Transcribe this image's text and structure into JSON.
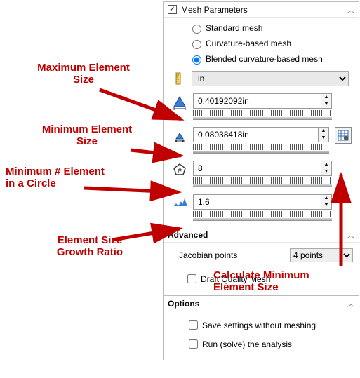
{
  "mesh_parameters": {
    "title": "Mesh Parameters",
    "checked": true,
    "radios": {
      "standard": "Standard mesh",
      "curvature": "Curvature-based mesh",
      "blended": "Blended curvature-based mesh"
    },
    "unit": "in",
    "max_element_size": "0.40192092in",
    "min_element_size": "0.08038418in",
    "min_elements_circle": "8",
    "growth_ratio": "1.6"
  },
  "advanced": {
    "title": "Advanced",
    "jacobian_label": "Jacobian points",
    "jacobian_value": "4 points",
    "draft_label": "Draft Quality Mesh"
  },
  "options": {
    "title": "Options",
    "save_label": "Save settings without meshing",
    "run_label": "Run (solve) the analysis"
  },
  "annotations": {
    "max_el": "Maximum Element\nSize",
    "min_el": "Minimum Element\nSize",
    "min_circle": "Minimum # Element\nin a Circle",
    "growth": "Element Size\nGrowth Ratio",
    "calc": "Calculate Minimum\nElement Size"
  },
  "icons": {
    "max_tri": "triangle-max",
    "min_tri": "triangle-min",
    "circle_hash": "hash-pentagon",
    "growth_tris": "growth-triangles",
    "calc_grid": "calc-grid"
  }
}
